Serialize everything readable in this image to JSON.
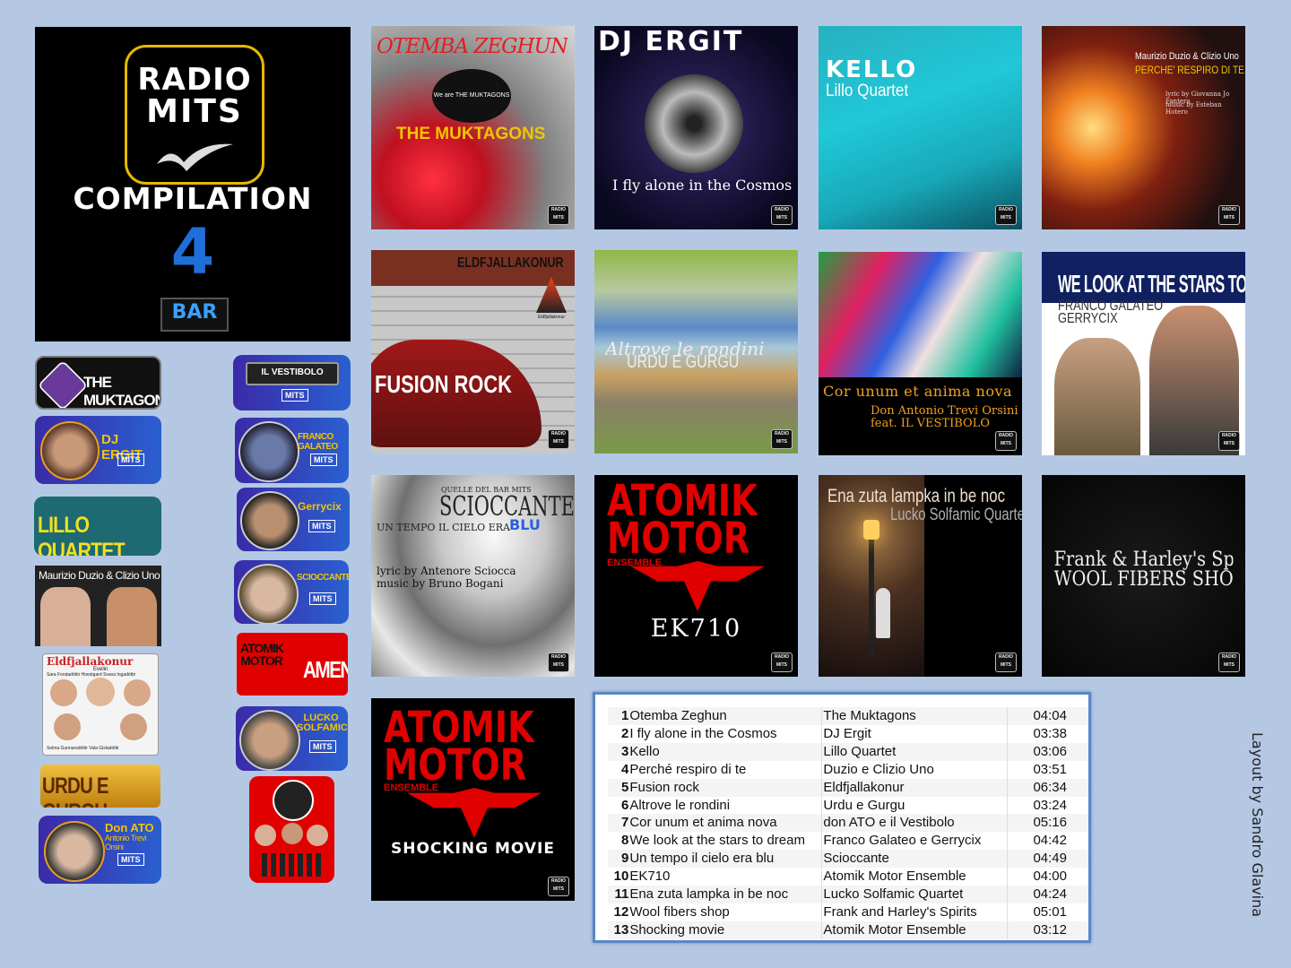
{
  "main_logo": {
    "radio": "RADIO",
    "mits": "MITS",
    "compilation": "COMPILATION",
    "number": "4",
    "bar": "BAR"
  },
  "badges": {
    "muktagons": "THE MUKTAGONS",
    "vestibolo": "IL VESTIBOLO",
    "dj_ergit": "DJ ERGIT",
    "franco_galateo": "FRANCO GALATEO",
    "gerrycix": "Gerrycix",
    "lillo_quartet": "LILLO QUARTET",
    "sciocante": "SCIOCCANTE",
    "duzio_clizio": "Maurizio Duzio & Clizio Uno",
    "atomik_motor": "ATOMIK MOTOR",
    "amen": "AMEN",
    "eldfjallakonur": "Eldfjallakonur",
    "eldf_names_top": "Sara Forstadóttir   Hoestgard   Svava Ingadóttir",
    "eldf_names_bottom": "Selma Gunnarsdóttir          Vala Gisladóttir",
    "eldf_evelin": "Evelin",
    "lucko_solfamic": "LUCKO SOLFAMIC",
    "urdu_gurgu": "URDU E GURGU",
    "don_ato": "Don ATO",
    "don_ato_sub": "Antonio Trevi Orsini",
    "mits_small": "MITS"
  },
  "covers": {
    "c1_title": "OTEMBA ZEGHUN",
    "c1_sub": "THE MUKTAGONS",
    "c1_inner": "We are THE MUKTAGONS",
    "c2_title": "DJ ERGIT",
    "c2_sub": "I fly alone in the Cosmos",
    "c3_title": "KELLO",
    "c3_sub": "Lillo Quartet",
    "c4_line1": "Maurizio Duzio & Clizio Uno",
    "c4_line2": "PERCHE' RESPIRO DI TE",
    "c4_line3": "lyric by Giovanna Jo Fantera",
    "c4_line4": "music by Esteban Hotero",
    "c5_top": "ELDFJALLAKONUR",
    "c5_title": "FUSION ROCK",
    "c5_small": "Eldfjallakonur",
    "c6_title": "Altrove le rondini",
    "c6_sub": "URDU E GURGU",
    "c7_title": "Cor unum et anima nova",
    "c7_sub1": "Don Antonio Trevi Orsini",
    "c7_sub2": "feat. IL VESTIBOLO",
    "c8_title": "WE LOOK AT THE STARS TO DREAM",
    "c8_sub1": "FRANCO GALATEO",
    "c8_sub2": "GERRYCIX",
    "c9_top": "QUELLE DEL BAR MITS",
    "c9_title": "SCIOCCANTE",
    "c9_sub_a": "UN TEMPO IL CIELO ERA",
    "c9_sub_b": "BLU",
    "c9_credit1": "lyric by Antenore Sciocca",
    "c9_credit2": "music by Bruno Bogani",
    "c10_line1": "ATOMIK",
    "c10_line2": "MOTOR",
    "c10_ens": "ENSEMBLE",
    "c10_title": "EK710",
    "c11_line1": "Ena zuta lampka in be noc",
    "c11_line2": "Lucko Solfamic Quartet",
    "c12_line1": "Frank & Harley's Spirits",
    "c12_line2": "WOOL FIBERS SHOP",
    "c13_line1": "ATOMIK",
    "c13_line2": "MOTOR",
    "c13_ens": "ENSEMBLE",
    "c13_title": "SHOCKING MOVIE",
    "radio_mits": "RADIO MITS"
  },
  "tracks": [
    {
      "n": "1",
      "title": "Otemba Zeghun",
      "artist": "The Muktagons",
      "time": "04:04"
    },
    {
      "n": "2",
      "title": "I fly alone in the Cosmos",
      "artist": "DJ Ergit",
      "time": "03:38"
    },
    {
      "n": "3",
      "title": "Kello",
      "artist": "Lillo Quartet",
      "time": "03:06"
    },
    {
      "n": "4",
      "title": "Perché respiro di te",
      "artist": "Duzio e Clizio Uno",
      "time": "03:51"
    },
    {
      "n": "5",
      "title": "Fusion rock",
      "artist": "Eldfjallakonur",
      "time": "06:34"
    },
    {
      "n": "6",
      "title": "Altrove le rondini",
      "artist": "Urdu e Gurgu",
      "time": "03:24"
    },
    {
      "n": "7",
      "title": "Cor unum et anima nova",
      "artist": "don ATO e il Vestibolo",
      "time": "05:16"
    },
    {
      "n": "8",
      "title": "We look at the stars to dream",
      "artist": "Franco Galateo e Gerrycix",
      "time": "04:42"
    },
    {
      "n": "9",
      "title": "Un tempo il cielo era blu",
      "artist": "Scioccante",
      "time": "04:49"
    },
    {
      "n": "10",
      "title": "EK710",
      "artist": "Atomik Motor Ensemble",
      "time": "04:00"
    },
    {
      "n": "11",
      "title": "Ena zuta lampka in be noc",
      "artist": "Lucko Solfamic Quartet",
      "time": "04:24"
    },
    {
      "n": "12",
      "title": "Wool fibers shop",
      "artist": "Frank and Harley's Spirits",
      "time": "05:01"
    },
    {
      "n": "13",
      "title": "Shocking movie",
      "artist": "Atomik Motor Ensemble",
      "time": "03:12"
    }
  ],
  "credit": "Layout by Sandro Glavina"
}
